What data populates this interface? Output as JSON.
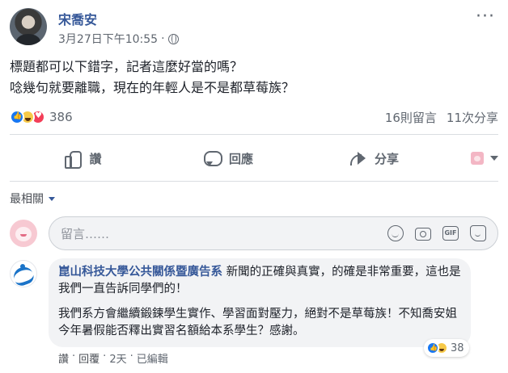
{
  "post": {
    "author": "宋喬安",
    "timestamp": "3月27日下午10:55",
    "separator": "·",
    "privacy_icon": "globe-icon",
    "more_icon": "more-icon",
    "text_line1": "標題都可以下錯字，記者這麼好當的嗎？",
    "text_line2": "唸幾句就要離職，現在的年輕人是不是都草莓族？"
  },
  "stats": {
    "reaction_types": [
      "like",
      "haha",
      "love"
    ],
    "reaction_count": "386",
    "comments": "16則留言",
    "shares": "11次分享"
  },
  "actions": {
    "like": "讚",
    "comment": "回應",
    "share": "分享"
  },
  "comments_section": {
    "sort_label": "最相關",
    "compose_placeholder": "留言……",
    "tools": [
      "emoji-icon",
      "camera-icon",
      "gif-icon",
      "sticker-icon"
    ],
    "gif_label": "GIF"
  },
  "comment": {
    "author": "崑山科技大學公共關係暨廣告系",
    "text_part1": " 新聞的正確與真實，的確是非常重要，這也是我們一直告訴同學們的！",
    "text_part2": "我們系方會繼續鍛鍊學生實作、學習面對壓力，絕對不是草莓族！不知喬安姐今年暑假能否釋出實習名額給本系學生？感謝。",
    "reaction_count": "38",
    "like_label": "讚",
    "reply_label": "回覆",
    "time": "2天",
    "edited_label": "已編輯",
    "dot": "·"
  },
  "colors": {
    "link_blue": "#365899",
    "like_blue": "#1877f2",
    "love_red": "#f33e58",
    "haha_yellow": "#f7c948",
    "secondary_text": "#606770"
  }
}
